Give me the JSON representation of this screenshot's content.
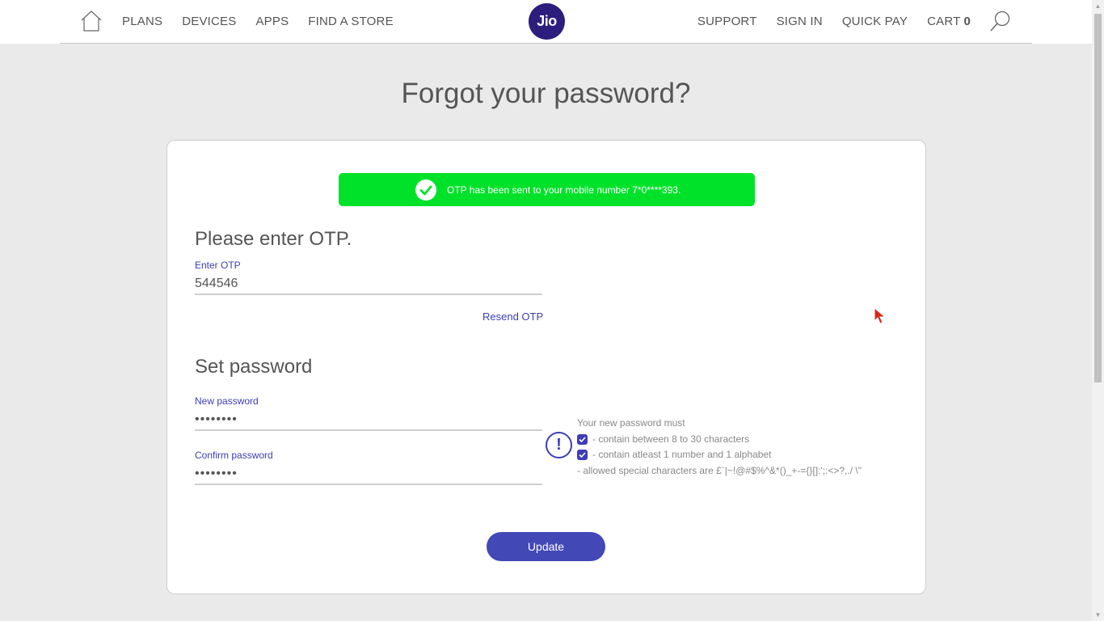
{
  "header": {
    "nav_left": [
      "PLANS",
      "DEVICES",
      "APPS",
      "FIND A STORE"
    ],
    "logo_text": "Jio",
    "nav_right": [
      "SUPPORT",
      "SIGN IN",
      "QUICK PAY"
    ],
    "cart_label": "CART",
    "cart_count": "0"
  },
  "page": {
    "title": "Forgot your password?"
  },
  "alert": {
    "message": "OTP has been sent to your mobile number 7*0****393.",
    "color": "#00e22a"
  },
  "otp": {
    "heading": "Please enter OTP.",
    "label": "Enter OTP",
    "value": "544546",
    "resend_label": "Resend OTP"
  },
  "password": {
    "heading": "Set password",
    "new_label": "New password",
    "new_value": "••••••••",
    "confirm_label": "Confirm password",
    "confirm_value": "••••••••",
    "rules_title": "Your new password must",
    "rule_length": "- contain between 8 to 30 characters",
    "rule_alnum": "- contain atleast 1 number and 1 alphabet",
    "rule_special": "- allowed special characters are £`|~!@#$%^&*()_+-={}[]:';:<>?,./ \\\""
  },
  "actions": {
    "update_label": "Update"
  },
  "colors": {
    "brand": "#2d1d7d",
    "accent": "#3d3db8",
    "button": "#4248b6"
  }
}
